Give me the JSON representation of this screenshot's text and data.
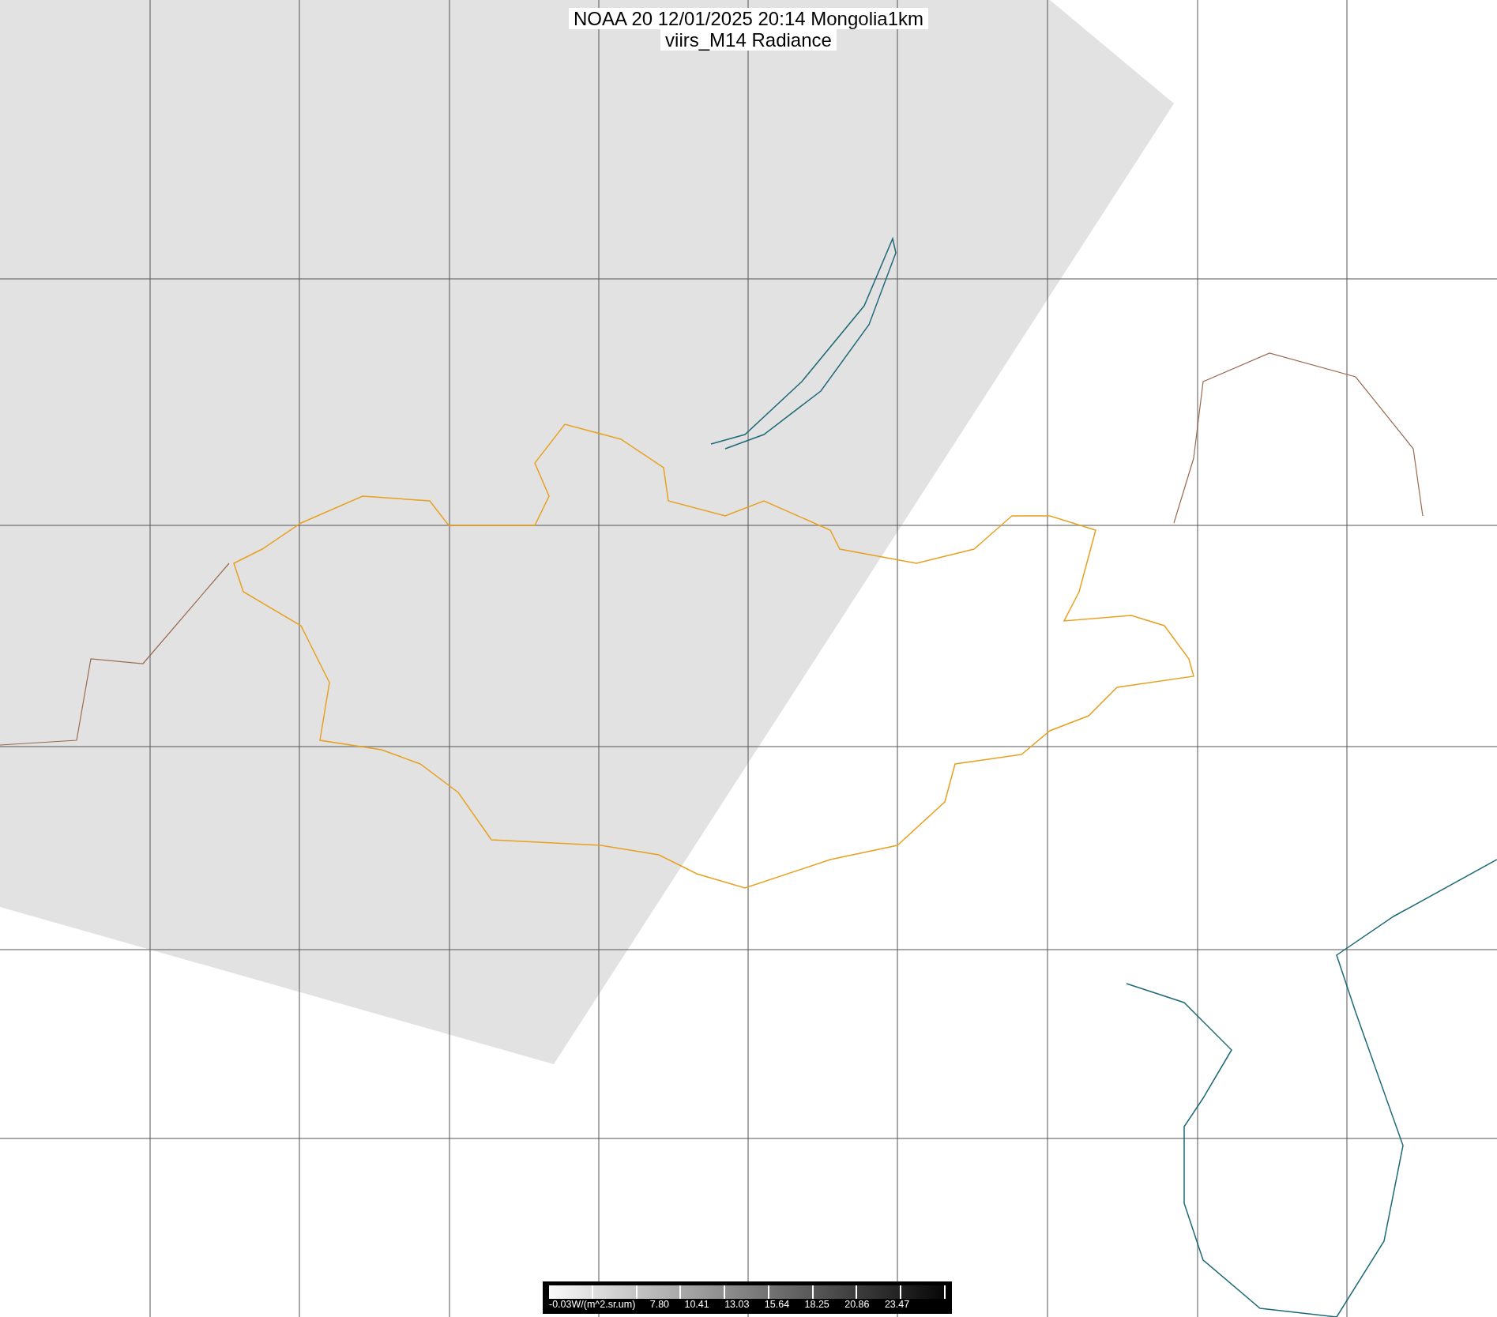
{
  "title": {
    "lines": [
      "NOAA 20 12/01/2025 20:14 Mongolia1km",
      "viirs_M14 Radiance"
    ]
  },
  "colorbar": {
    "labels": [
      "-0.03W/(m^2.sr.um)",
      "7.80",
      "10.41",
      "13.03",
      "15.64",
      "18.25",
      "20.86",
      "23.47"
    ]
  }
}
